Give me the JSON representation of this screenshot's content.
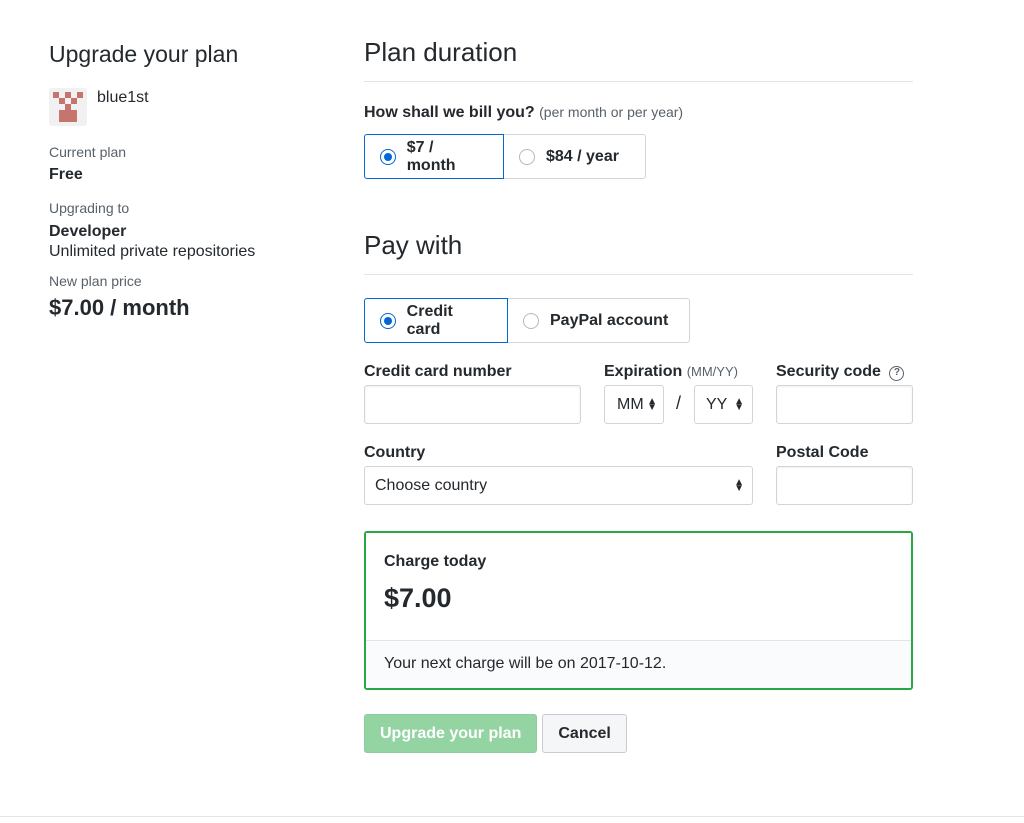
{
  "sidebar": {
    "title": "Upgrade your plan",
    "username": "blue1st",
    "current_plan_label": "Current plan",
    "current_plan_value": "Free",
    "upgrading_to_label": "Upgrading to",
    "upgrading_to_value": "Developer",
    "upgrading_to_desc": "Unlimited private repositories",
    "new_price_label": "New plan price",
    "new_price_value": "$7.00 / month"
  },
  "duration": {
    "title": "Plan duration",
    "question": "How shall we bill you?",
    "question_hint": "(per month or per year)",
    "options": [
      {
        "label": "$7 / month",
        "selected": true
      },
      {
        "label": "$84 / year",
        "selected": false
      }
    ]
  },
  "pay": {
    "title": "Pay with",
    "options": [
      {
        "label": "Credit card",
        "selected": true
      },
      {
        "label": "PayPal account",
        "selected": false
      }
    ],
    "card_number_label": "Credit card number",
    "expiration_label": "Expiration",
    "expiration_hint": "(MM/YY)",
    "month_value": "MM",
    "year_value": "YY",
    "slash": "/",
    "security_label": "Security code",
    "help_glyph": "?",
    "country_label": "Country",
    "country_value": "Choose country",
    "postal_label": "Postal Code"
  },
  "charge": {
    "label": "Charge today",
    "amount": "$7.00",
    "next": "Your next charge will be on 2017-10-12."
  },
  "actions": {
    "upgrade_label": "Upgrade your plan",
    "cancel_label": "Cancel"
  },
  "colors": {
    "accent_blue": "#0366d6",
    "success_green": "#28a745",
    "disabled_button": "#94d3a2",
    "avatar_pattern": "#c5756e"
  }
}
